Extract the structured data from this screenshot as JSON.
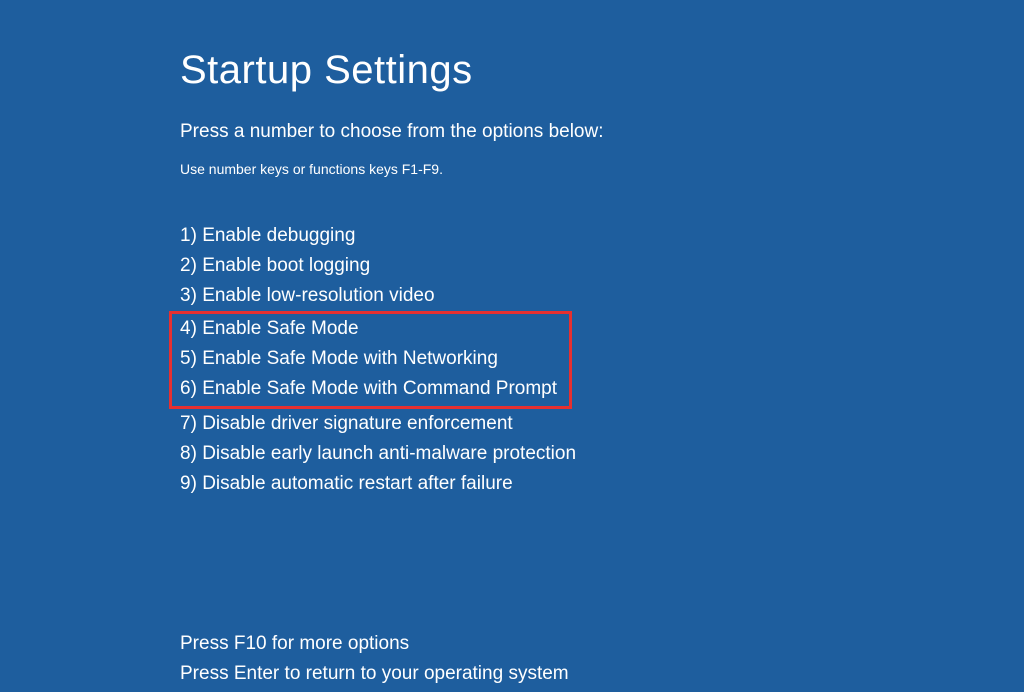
{
  "title": "Startup Settings",
  "subtitle": "Press a number to choose from the options below:",
  "hint": "Use number keys or functions keys F1-F9.",
  "options": [
    {
      "num": "1",
      "label": "Enable debugging"
    },
    {
      "num": "2",
      "label": "Enable boot logging"
    },
    {
      "num": "3",
      "label": "Enable low-resolution video"
    },
    {
      "num": "4",
      "label": "Enable Safe Mode"
    },
    {
      "num": "5",
      "label": "Enable Safe Mode with Networking"
    },
    {
      "num": "6",
      "label": "Enable Safe Mode with Command Prompt"
    },
    {
      "num": "7",
      "label": "Disable driver signature enforcement"
    },
    {
      "num": "8",
      "label": "Disable early launch anti-malware protection"
    },
    {
      "num": "9",
      "label": "Disable automatic restart after failure"
    }
  ],
  "footer": {
    "line1": "Press F10 for more options",
    "line2": "Press Enter to return to your operating system"
  },
  "highlighted_range": {
    "start": 3,
    "end": 5
  }
}
